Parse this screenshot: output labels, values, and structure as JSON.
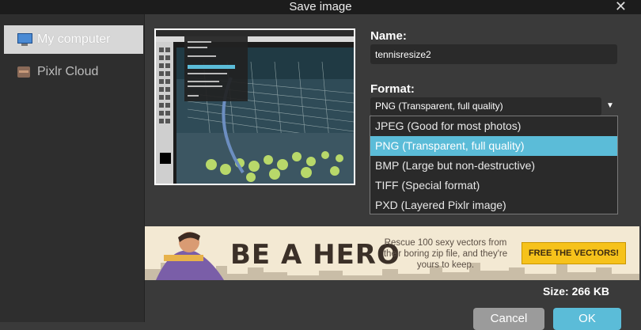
{
  "dialog": {
    "title": "Save image"
  },
  "sidebar": {
    "items": [
      {
        "label": "My computer",
        "icon": "monitor-icon"
      },
      {
        "label": "Pixlr Cloud",
        "icon": "cloud-storage-icon"
      }
    ]
  },
  "form": {
    "name_label": "Name:",
    "name_value": "tennisresize2",
    "format_label": "Format:",
    "format_selected": "PNG (Transparent, full quality)",
    "format_options": [
      "JPEG (Good for most photos)",
      "PNG (Transparent, full quality)",
      "BMP (Large but non-destructive)",
      "TIFF (Special format)",
      "PXD (Layered Pixlr image)"
    ],
    "size_text": "Size: 266 KB"
  },
  "banner": {
    "headline": "BE A HERO",
    "tagline": "Rescue 100 sexy vectors from their boring zip file, and they're yours to keep.",
    "cta": "FREE THE VECTORS!"
  },
  "buttons": {
    "cancel": "Cancel",
    "ok": "OK"
  },
  "colors": {
    "accent": "#5bbcd8",
    "dialog_bg": "#3a3a3a",
    "sidebar_bg": "#2e2e2e"
  }
}
